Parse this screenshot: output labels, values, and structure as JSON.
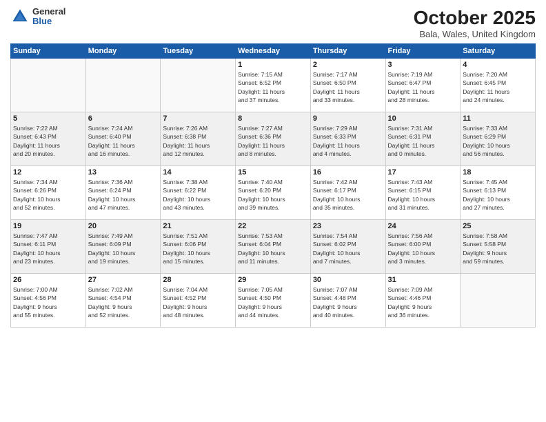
{
  "logo": {
    "general": "General",
    "blue": "Blue"
  },
  "header": {
    "month": "October 2025",
    "location": "Bala, Wales, United Kingdom"
  },
  "weekdays": [
    "Sunday",
    "Monday",
    "Tuesday",
    "Wednesday",
    "Thursday",
    "Friday",
    "Saturday"
  ],
  "weeks": [
    [
      {
        "day": "",
        "info": ""
      },
      {
        "day": "",
        "info": ""
      },
      {
        "day": "",
        "info": ""
      },
      {
        "day": "1",
        "info": "Sunrise: 7:15 AM\nSunset: 6:52 PM\nDaylight: 11 hours\nand 37 minutes."
      },
      {
        "day": "2",
        "info": "Sunrise: 7:17 AM\nSunset: 6:50 PM\nDaylight: 11 hours\nand 33 minutes."
      },
      {
        "day": "3",
        "info": "Sunrise: 7:19 AM\nSunset: 6:47 PM\nDaylight: 11 hours\nand 28 minutes."
      },
      {
        "day": "4",
        "info": "Sunrise: 7:20 AM\nSunset: 6:45 PM\nDaylight: 11 hours\nand 24 minutes."
      }
    ],
    [
      {
        "day": "5",
        "info": "Sunrise: 7:22 AM\nSunset: 6:43 PM\nDaylight: 11 hours\nand 20 minutes."
      },
      {
        "day": "6",
        "info": "Sunrise: 7:24 AM\nSunset: 6:40 PM\nDaylight: 11 hours\nand 16 minutes."
      },
      {
        "day": "7",
        "info": "Sunrise: 7:26 AM\nSunset: 6:38 PM\nDaylight: 11 hours\nand 12 minutes."
      },
      {
        "day": "8",
        "info": "Sunrise: 7:27 AM\nSunset: 6:36 PM\nDaylight: 11 hours\nand 8 minutes."
      },
      {
        "day": "9",
        "info": "Sunrise: 7:29 AM\nSunset: 6:33 PM\nDaylight: 11 hours\nand 4 minutes."
      },
      {
        "day": "10",
        "info": "Sunrise: 7:31 AM\nSunset: 6:31 PM\nDaylight: 11 hours\nand 0 minutes."
      },
      {
        "day": "11",
        "info": "Sunrise: 7:33 AM\nSunset: 6:29 PM\nDaylight: 10 hours\nand 56 minutes."
      }
    ],
    [
      {
        "day": "12",
        "info": "Sunrise: 7:34 AM\nSunset: 6:26 PM\nDaylight: 10 hours\nand 52 minutes."
      },
      {
        "day": "13",
        "info": "Sunrise: 7:36 AM\nSunset: 6:24 PM\nDaylight: 10 hours\nand 47 minutes."
      },
      {
        "day": "14",
        "info": "Sunrise: 7:38 AM\nSunset: 6:22 PM\nDaylight: 10 hours\nand 43 minutes."
      },
      {
        "day": "15",
        "info": "Sunrise: 7:40 AM\nSunset: 6:20 PM\nDaylight: 10 hours\nand 39 minutes."
      },
      {
        "day": "16",
        "info": "Sunrise: 7:42 AM\nSunset: 6:17 PM\nDaylight: 10 hours\nand 35 minutes."
      },
      {
        "day": "17",
        "info": "Sunrise: 7:43 AM\nSunset: 6:15 PM\nDaylight: 10 hours\nand 31 minutes."
      },
      {
        "day": "18",
        "info": "Sunrise: 7:45 AM\nSunset: 6:13 PM\nDaylight: 10 hours\nand 27 minutes."
      }
    ],
    [
      {
        "day": "19",
        "info": "Sunrise: 7:47 AM\nSunset: 6:11 PM\nDaylight: 10 hours\nand 23 minutes."
      },
      {
        "day": "20",
        "info": "Sunrise: 7:49 AM\nSunset: 6:09 PM\nDaylight: 10 hours\nand 19 minutes."
      },
      {
        "day": "21",
        "info": "Sunrise: 7:51 AM\nSunset: 6:06 PM\nDaylight: 10 hours\nand 15 minutes."
      },
      {
        "day": "22",
        "info": "Sunrise: 7:53 AM\nSunset: 6:04 PM\nDaylight: 10 hours\nand 11 minutes."
      },
      {
        "day": "23",
        "info": "Sunrise: 7:54 AM\nSunset: 6:02 PM\nDaylight: 10 hours\nand 7 minutes."
      },
      {
        "day": "24",
        "info": "Sunrise: 7:56 AM\nSunset: 6:00 PM\nDaylight: 10 hours\nand 3 minutes."
      },
      {
        "day": "25",
        "info": "Sunrise: 7:58 AM\nSunset: 5:58 PM\nDaylight: 9 hours\nand 59 minutes."
      }
    ],
    [
      {
        "day": "26",
        "info": "Sunrise: 7:00 AM\nSunset: 4:56 PM\nDaylight: 9 hours\nand 55 minutes."
      },
      {
        "day": "27",
        "info": "Sunrise: 7:02 AM\nSunset: 4:54 PM\nDaylight: 9 hours\nand 52 minutes."
      },
      {
        "day": "28",
        "info": "Sunrise: 7:04 AM\nSunset: 4:52 PM\nDaylight: 9 hours\nand 48 minutes."
      },
      {
        "day": "29",
        "info": "Sunrise: 7:05 AM\nSunset: 4:50 PM\nDaylight: 9 hours\nand 44 minutes."
      },
      {
        "day": "30",
        "info": "Sunrise: 7:07 AM\nSunset: 4:48 PM\nDaylight: 9 hours\nand 40 minutes."
      },
      {
        "day": "31",
        "info": "Sunrise: 7:09 AM\nSunset: 4:46 PM\nDaylight: 9 hours\nand 36 minutes."
      },
      {
        "day": "",
        "info": ""
      }
    ]
  ]
}
